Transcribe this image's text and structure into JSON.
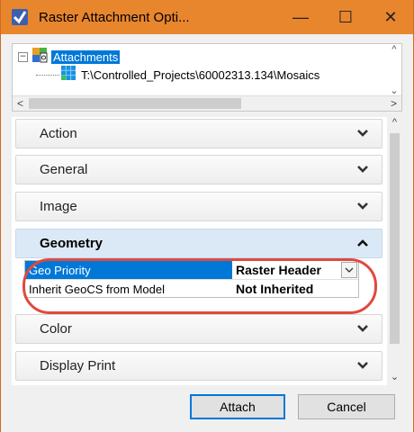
{
  "window": {
    "title": "Raster Attachment Opti...",
    "minimize_glyph": "—",
    "maximize_glyph": "☐",
    "close_glyph": "✕",
    "title_bar_color": "#e8862e"
  },
  "tree": {
    "root_label": "Attachments",
    "expand_glyph": "−",
    "child_path": "T:\\Controlled_Projects\\60002313.134\\Mosaics"
  },
  "sections": [
    {
      "label": "Action",
      "icon": "chevron-down-icon"
    },
    {
      "label": "General",
      "icon": "chevron-down-icon"
    },
    {
      "label": "Image",
      "icon": "chevron-down-icon"
    },
    {
      "label": "Geometry",
      "icon": "chevron-up-icon"
    },
    {
      "label": "Color",
      "icon": "chevron-down-icon"
    },
    {
      "label": "Display Print",
      "icon": "chevron-down-icon"
    }
  ],
  "geometry": {
    "rows": [
      {
        "name": "Geo Priority",
        "value": "Raster Header"
      },
      {
        "name": "Inherit GeoCS from Model",
        "value": "Not Inherited"
      }
    ]
  },
  "buttons": {
    "attach": "Attach",
    "cancel": "Cancel"
  },
  "colors": {
    "selection": "#0078d7",
    "highlight_ring": "#e0493f"
  }
}
